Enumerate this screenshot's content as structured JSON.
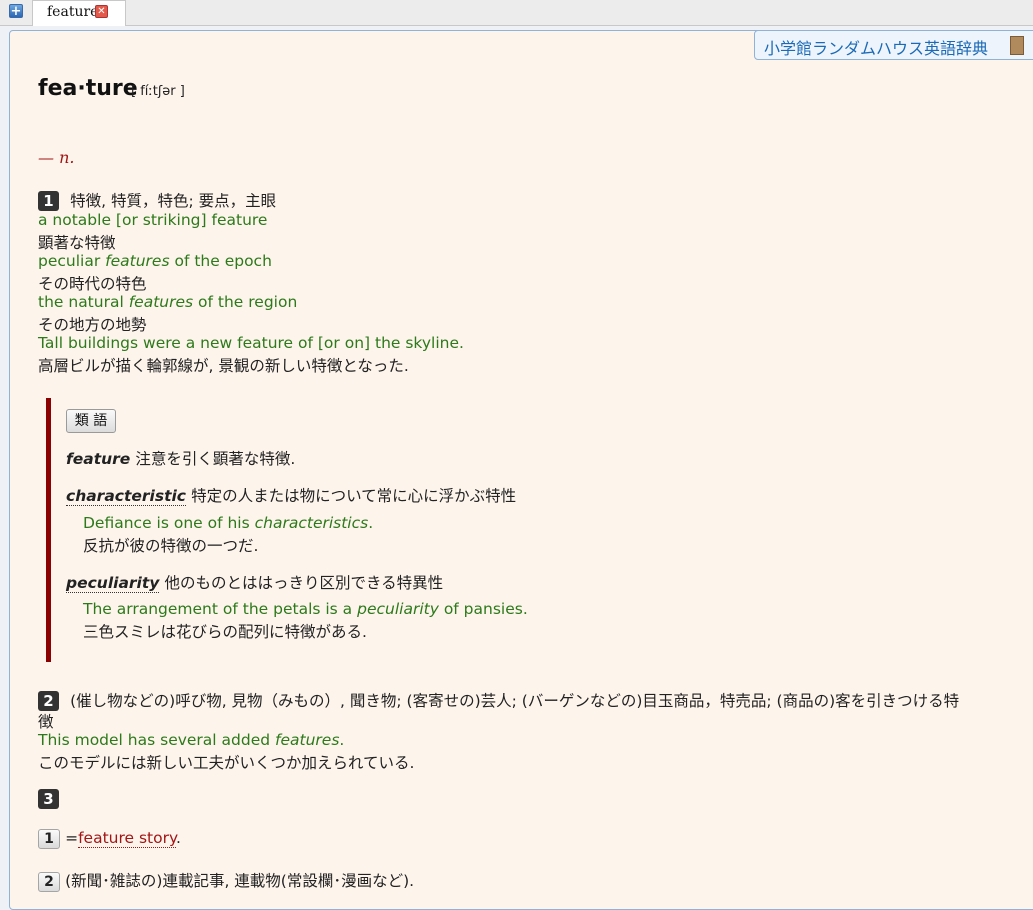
{
  "tabs": [
    {
      "label": "feature"
    }
  ],
  "dictionary_name": "小学館ランダムハウス英語辞典",
  "entry": {
    "headword": "fea·ture",
    "pronunciation": "[ fíːtʃər ]",
    "pos": "— n.",
    "sense1": {
      "num": "1",
      "definition": "特徴, 特質，特色; 要点，主眼",
      "examples": [
        {
          "en_plain": "a notable [or striking] feature",
          "ja": "顕著な特徴"
        },
        {
          "en_pre": "peculiar ",
          "en_em": "features",
          "en_post": " of the epoch",
          "ja": "その時代の特色"
        },
        {
          "en_pre": "the natural ",
          "en_em": "features",
          "en_post": " of the region",
          "ja": "その地方の地勢"
        },
        {
          "en_plain": "Tall buildings were a new feature of [or on] the skyline.",
          "ja": "高層ビルが描く輪郭線が, 景観の新しい特徴となった."
        }
      ]
    },
    "synonyms": {
      "button_label": "類 語",
      "items": [
        {
          "word": "feature",
          "definition": "注意を引く顕著な特徴."
        },
        {
          "word": "characteristic",
          "definition": "特定の人または物について常に心に浮かぶ特性",
          "example_pre": "Defiance is one of his ",
          "example_em": "characteristics",
          "example_post": ".",
          "example_ja": "反抗が彼の特徴の一つだ."
        },
        {
          "word": "peculiarity",
          "definition": "他のものとははっきり区別できる特異性",
          "example_pre": "The arrangement of the petals is a ",
          "example_em": "peculiarity",
          "example_post": " of pansies.",
          "example_ja": "三色スミレは花びらの配列に特徴がある."
        }
      ]
    },
    "sense2": {
      "num": "2",
      "definition_line1": "(催し物などの)呼び物, 見物（みもの）, 聞き物; (客寄せの)芸人; (バーゲンなどの)目玉商品，特売品; (商品の)客を引きつける特",
      "definition_line2": "徴",
      "example_pre": "This model has several added ",
      "example_em": "features",
      "example_post": ".",
      "example_ja": "このモデルには新しい工夫がいくつか加えられている."
    },
    "sense3": {
      "num": "3",
      "sub1_num": "1",
      "sub1_prefix": "=",
      "sub1_link": "feature story",
      "sub1_suffix": ".",
      "sub2_num": "2",
      "sub2_text": "(新聞･雑誌の)連載記事, 連載物(常設欄･漫画など)."
    }
  }
}
